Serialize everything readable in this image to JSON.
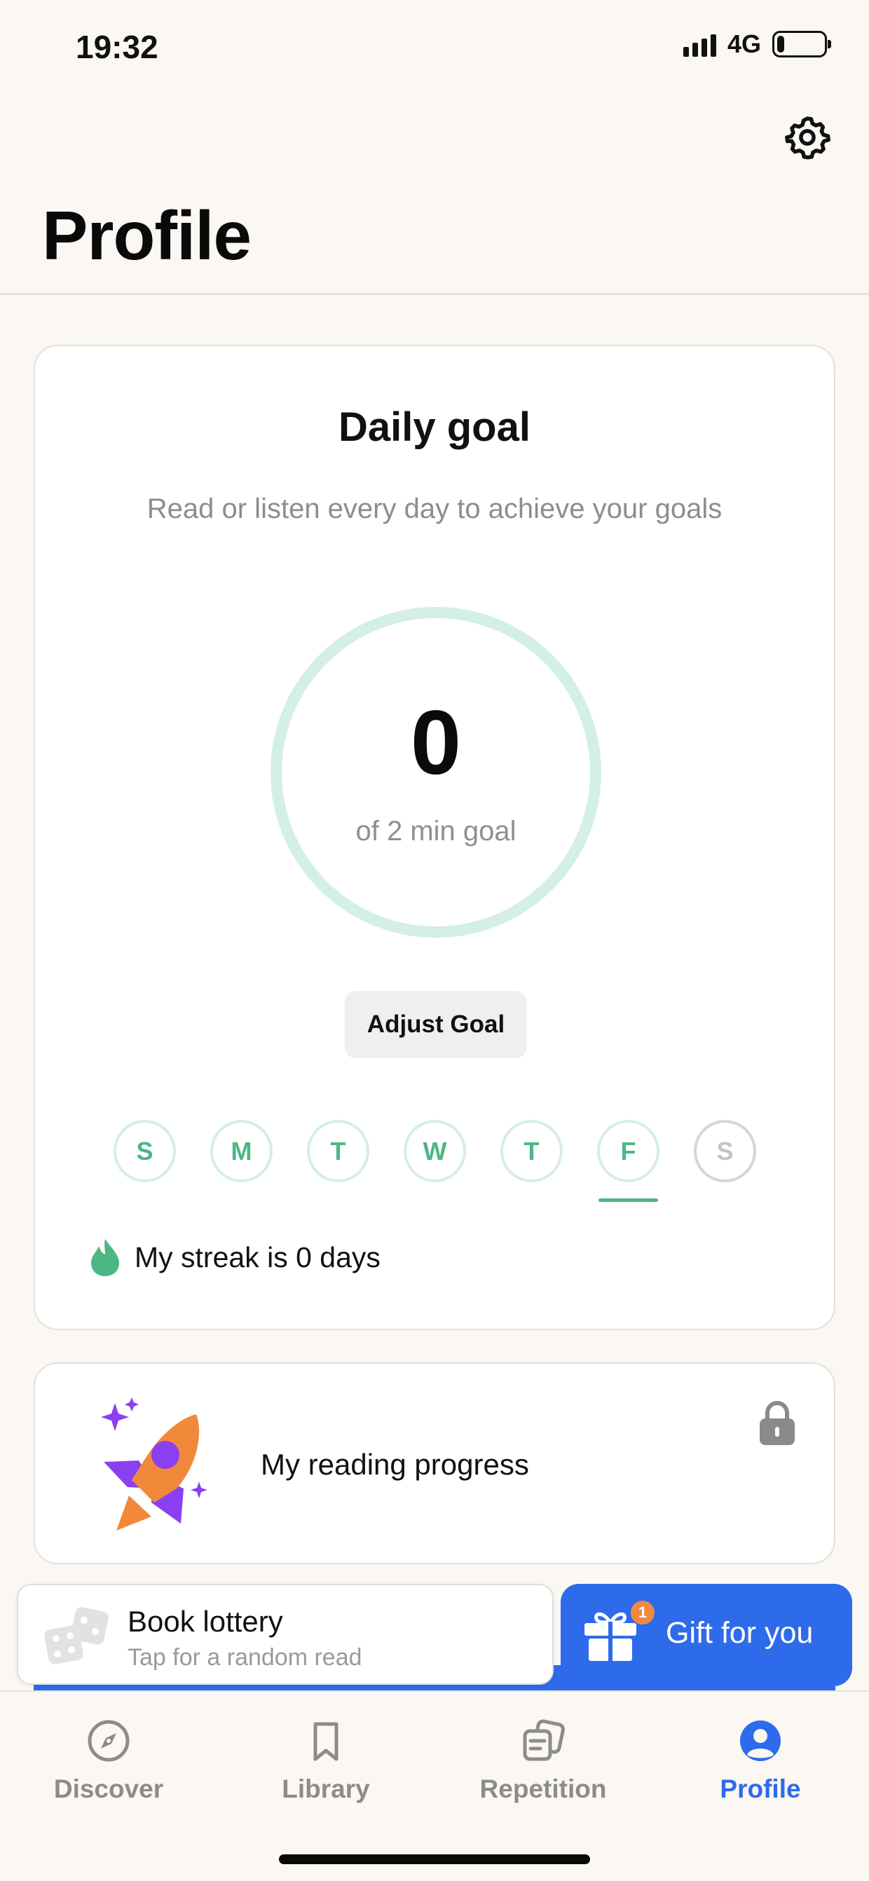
{
  "status_bar": {
    "time": "19:32",
    "network": "4G",
    "battery_level": 0.15
  },
  "header": {
    "title": "Profile",
    "settings_icon": "gear-icon"
  },
  "daily_goal": {
    "title": "Daily goal",
    "subtitle": "Read or listen every day to achieve your goals",
    "value": "0",
    "caption": "of 2 min goal",
    "progress": 0,
    "adjust_label": "Adjust Goal",
    "days": [
      {
        "letter": "S",
        "state": "past"
      },
      {
        "letter": "M",
        "state": "past"
      },
      {
        "letter": "T",
        "state": "past"
      },
      {
        "letter": "W",
        "state": "past"
      },
      {
        "letter": "T",
        "state": "past"
      },
      {
        "letter": "F",
        "state": "today"
      },
      {
        "letter": "S",
        "state": "future"
      }
    ],
    "streak_text": "My streak is 0 days"
  },
  "reading_progress": {
    "label": "My reading progress",
    "locked": true
  },
  "lottery": {
    "title": "Book lottery",
    "subtitle": "Tap for a random read"
  },
  "gift": {
    "label": "Gift for you",
    "badge": "1"
  },
  "bottom_nav": {
    "items": [
      {
        "label": "Discover",
        "icon": "compass-icon",
        "active": false
      },
      {
        "label": "Library",
        "icon": "bookmark-icon",
        "active": false
      },
      {
        "label": "Repetition",
        "icon": "cards-icon",
        "active": false
      },
      {
        "label": "Profile",
        "icon": "user-icon",
        "active": true
      }
    ]
  },
  "colors": {
    "background": "#fbf7f3",
    "accent_blue": "#2d6bea",
    "goal_green": "#4cb783",
    "ring_light": "#d4efe3",
    "badge_orange": "#f08a43",
    "rocket_orange": "#f08a3a",
    "rocket_purple": "#8a3ff0"
  }
}
